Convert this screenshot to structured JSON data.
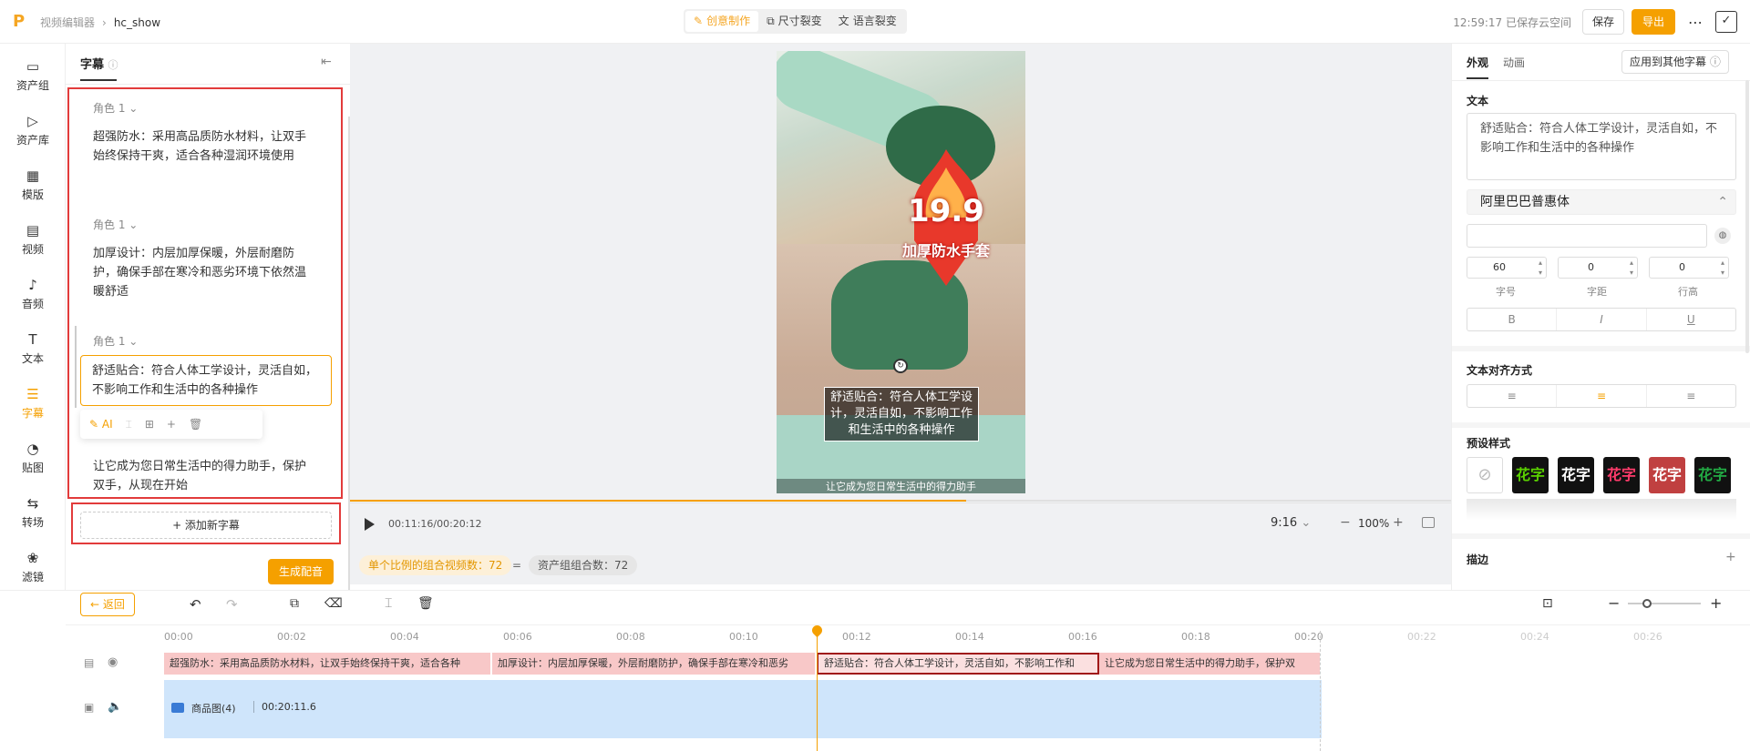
{
  "header": {
    "breadcrumb_parent": "视频编辑器",
    "breadcrumb_current": "hc_show",
    "modes": [
      {
        "label": "创意制作",
        "active": true
      },
      {
        "label": "尺寸裂变",
        "active": false
      },
      {
        "label": "语言裂变",
        "active": false
      }
    ],
    "save_status": "12:59:17 已保存云空间",
    "save_label": "保存",
    "export_label": "导出"
  },
  "nav": {
    "items": [
      {
        "label": "资产组",
        "icon": "folder-icon"
      },
      {
        "label": "资产库",
        "icon": "media-library-icon"
      },
      {
        "label": "模版",
        "icon": "template-icon"
      },
      {
        "label": "视频",
        "icon": "film-icon"
      },
      {
        "label": "音频",
        "icon": "music-icon"
      },
      {
        "label": "文本",
        "icon": "text-icon"
      },
      {
        "label": "字幕",
        "icon": "subtitle-icon",
        "active": true
      },
      {
        "label": "贴图",
        "icon": "sticker-icon"
      },
      {
        "label": "转场",
        "icon": "transition-icon"
      },
      {
        "label": "滤镜",
        "icon": "filter-icon"
      }
    ]
  },
  "subtitles": {
    "title": "字幕",
    "items": [
      {
        "role": "角色 1",
        "text": "超强防水：采用高品质防水材料，让双手始终保持干爽，适合各种湿润环境使用"
      },
      {
        "role": "角色 1",
        "text": "加厚设计：内层加厚保暖，外层耐磨防护，确保手部在寒冷和恶劣环境下依然温暖舒适"
      },
      {
        "role": "角色 1",
        "text": "舒适贴合：符合人体工学设计，灵活自如，不影响工作和生活中的各种操作"
      },
      {
        "role": "",
        "text": "让它成为您日常生活中的得力助手，保护双手，从现在开始"
      }
    ],
    "ai_label": "AI",
    "add_label": "+ 添加新字幕",
    "generate_label": "生成配音"
  },
  "preview": {
    "price": "19.9",
    "product_title": "加厚防水手套",
    "caption": "舒适贴合：符合人体工学设计，灵活自如，不影响工作和生活中的各种操作",
    "bottom_caption": "让它成为您日常生活中的得力助手",
    "time": "00:11:16/00:20:12",
    "ratio": "9:16",
    "zoom": "100%",
    "progress": 0.56
  },
  "stats": {
    "combo_label": "单个比例的组合视频数：72",
    "equals": "=",
    "asset_label": "资产组组合数：72"
  },
  "right": {
    "tabs": [
      "外观",
      "动画"
    ],
    "apply_label": "应用到其他字幕",
    "text_section": "文本",
    "text_value": "舒适贴合：符合人体工学设计，灵活自如，不影响工作和生活中的各种操作",
    "font_name": "阿里巴巴普惠体",
    "font_size": "60",
    "letter_spacing": "0",
    "line_height": "0",
    "font_size_label": "字号",
    "letter_spacing_label": "字距",
    "line_height_label": "行高",
    "bold": "B",
    "italic": "I",
    "underline": "U",
    "align_section": "文本对齐方式",
    "preset_section": "预设样式",
    "preset_label": "花字",
    "stroke_section": "描边",
    "preset_colors": [
      "#5ad100",
      "#ffffff",
      "#ff3b6b",
      "#c04040",
      "#22aa44"
    ]
  },
  "timeline": {
    "back_label": "返回",
    "ticks": [
      "00:00",
      "00:02",
      "00:04",
      "00:06",
      "00:08",
      "00:10",
      "00:12",
      "00:14",
      "00:16",
      "00:18",
      "00:20",
      "00:22",
      "00:24",
      "00:26"
    ],
    "clips": [
      "超强防水：采用高品质防水材料，让双手始终保持干爽，适合各种",
      "加厚设计：内层加厚保暖，外层耐磨防护，确保手部在寒冷和恶劣",
      "舒适贴合：符合人体工学设计，灵活自如，不影响工作和",
      "让它成为您日常生活中的得力助手，保护双"
    ],
    "image_label": "商品图(4)",
    "image_duration": "00:20:11.6"
  }
}
